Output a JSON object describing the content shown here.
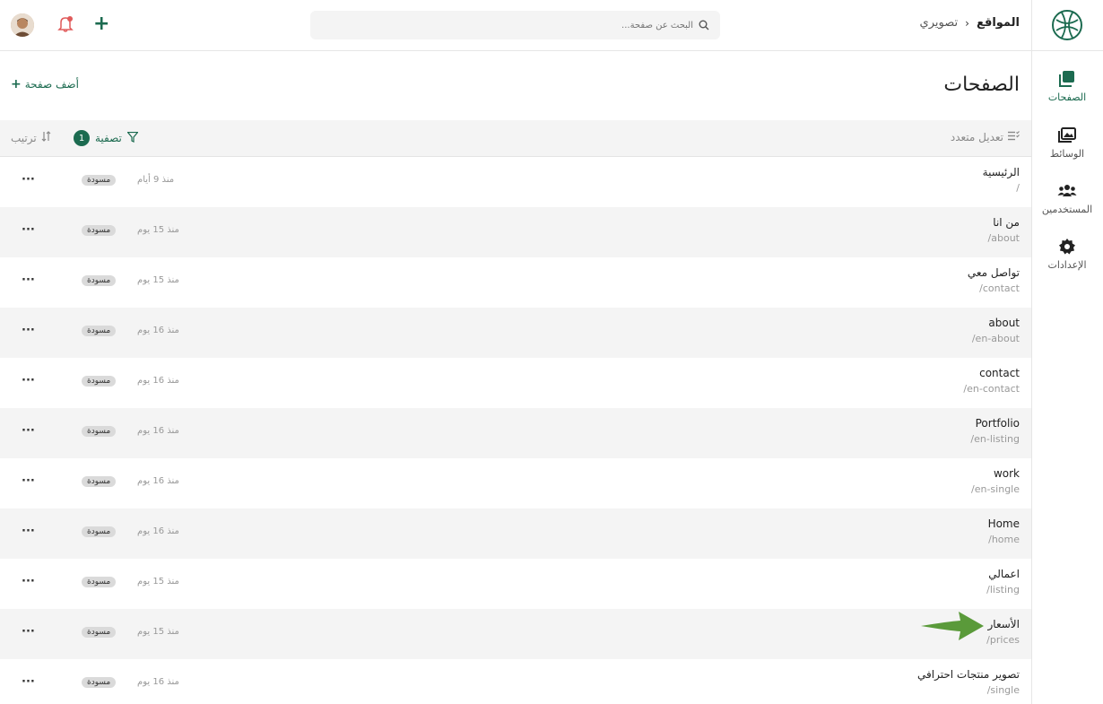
{
  "breadcrumb": {
    "root": "المواقع",
    "current": "تصويري"
  },
  "search": {
    "placeholder": "البحث عن صفحة..."
  },
  "rail": {
    "items": [
      {
        "label": "الصفحات",
        "icon": "pages-icon"
      },
      {
        "label": "الوسائط",
        "icon": "media-icon"
      },
      {
        "label": "المستخدمين",
        "icon": "users-icon"
      },
      {
        "label": "الإعدادات",
        "icon": "gear-icon"
      }
    ]
  },
  "header": {
    "title": "الصفحات",
    "add_label": "أضف صفحة"
  },
  "toolbar": {
    "bulk_edit": "تعديل متعدد",
    "filter": "تصفية",
    "filter_count": "1",
    "sort": "ترتيب"
  },
  "pages": [
    {
      "title": "الرئيسية",
      "slug": "/",
      "time": "منذ 9 أيام",
      "status": "مسودة"
    },
    {
      "title": "من انا",
      "slug": "/about",
      "time": "منذ 15 يوم",
      "status": "مسودة"
    },
    {
      "title": "تواصل معي",
      "slug": "/contact",
      "time": "منذ 15 يوم",
      "status": "مسودة"
    },
    {
      "title": "about",
      "slug": "/en-about",
      "time": "منذ 16 يوم",
      "status": "مسودة"
    },
    {
      "title": "contact",
      "slug": "/en-contact",
      "time": "منذ 16 يوم",
      "status": "مسودة"
    },
    {
      "title": "Portfolio",
      "slug": "/en-listing",
      "time": "منذ 16 يوم",
      "status": "مسودة"
    },
    {
      "title": "work",
      "slug": "/en-single",
      "time": "منذ 16 يوم",
      "status": "مسودة"
    },
    {
      "title": "Home",
      "slug": "/home",
      "time": "منذ 16 يوم",
      "status": "مسودة"
    },
    {
      "title": "اعمالي",
      "slug": "/listing",
      "time": "منذ 15 يوم",
      "status": "مسودة"
    },
    {
      "title": "الأسعار",
      "slug": "/prices",
      "time": "منذ 15 يوم",
      "status": "مسودة"
    },
    {
      "title": "تصوير منتجات احترافي",
      "slug": "/single",
      "time": "منذ 16 يوم",
      "status": "مسودة"
    }
  ],
  "row_menu_label": "···",
  "colors": {
    "accent": "#1c6b50",
    "annotation_arrow": "#5a9a3a"
  }
}
